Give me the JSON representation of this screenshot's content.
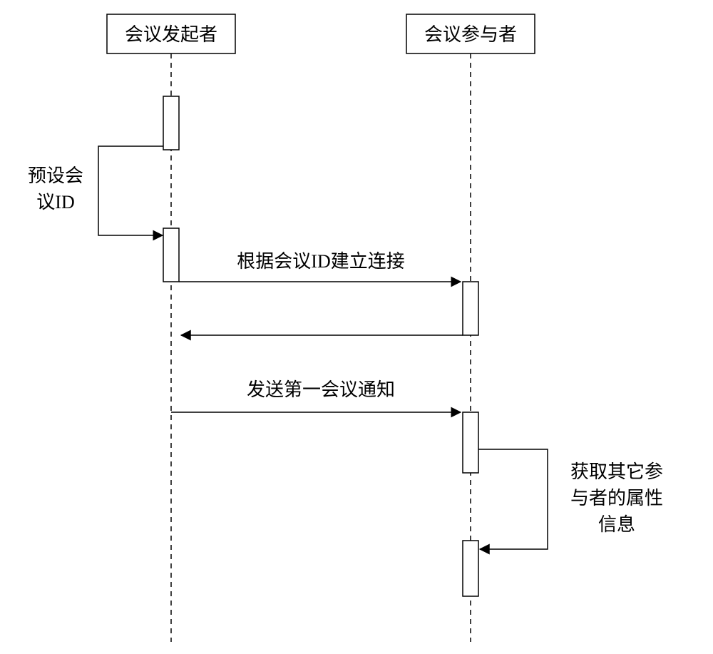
{
  "chart_data": {
    "type": "sequence-diagram",
    "lifelines": [
      {
        "id": "initiator",
        "label": "会议发起者"
      },
      {
        "id": "participant",
        "label": "会议参与者"
      }
    ],
    "messages": [
      {
        "from": "initiator",
        "to": "initiator",
        "label": "预设会议ID",
        "kind": "self"
      },
      {
        "from": "initiator",
        "to": "participant",
        "label": "根据会议ID建立连接",
        "kind": "call"
      },
      {
        "from": "participant",
        "to": "initiator",
        "label": "",
        "kind": "return"
      },
      {
        "from": "initiator",
        "to": "participant",
        "label": "发送第一会议通知",
        "kind": "call"
      },
      {
        "from": "participant",
        "to": "participant",
        "label": "获取其它参与者的属性信息",
        "kind": "self"
      }
    ]
  },
  "lifeline_initiator": "会议发起者",
  "lifeline_participant": "会议参与者",
  "self_msg_line1": "预设会",
  "self_msg_line2": "议ID",
  "msg_connect": "根据会议ID建立连接",
  "msg_notify": "发送第一会议通知",
  "self2_line1": "获取其它参",
  "self2_line2": "与者的属性",
  "self2_line3": "信息"
}
